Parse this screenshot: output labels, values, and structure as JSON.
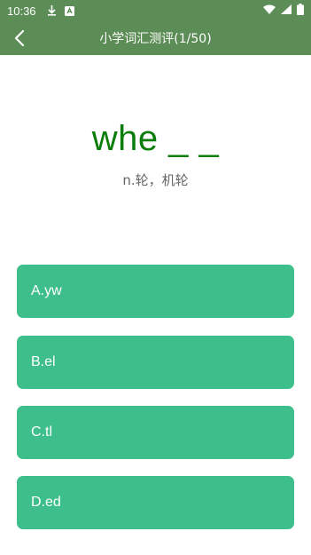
{
  "status_bar": {
    "time": "10:36",
    "icons": [
      "download-icon",
      "notification-icon",
      "wifi-icon",
      "signal-icon",
      "battery-icon"
    ]
  },
  "app_bar": {
    "title": "小学词汇测评(1/50)",
    "background_color": "#5c8d56"
  },
  "question": {
    "word": "whe _ _",
    "meaning": "n.轮，机轮",
    "word_color": "#0a7d0a"
  },
  "options": [
    {
      "label": "A.yw"
    },
    {
      "label": "B.el"
    },
    {
      "label": "C.tl"
    },
    {
      "label": "D.ed"
    }
  ],
  "option_color": "#3dbe8b"
}
